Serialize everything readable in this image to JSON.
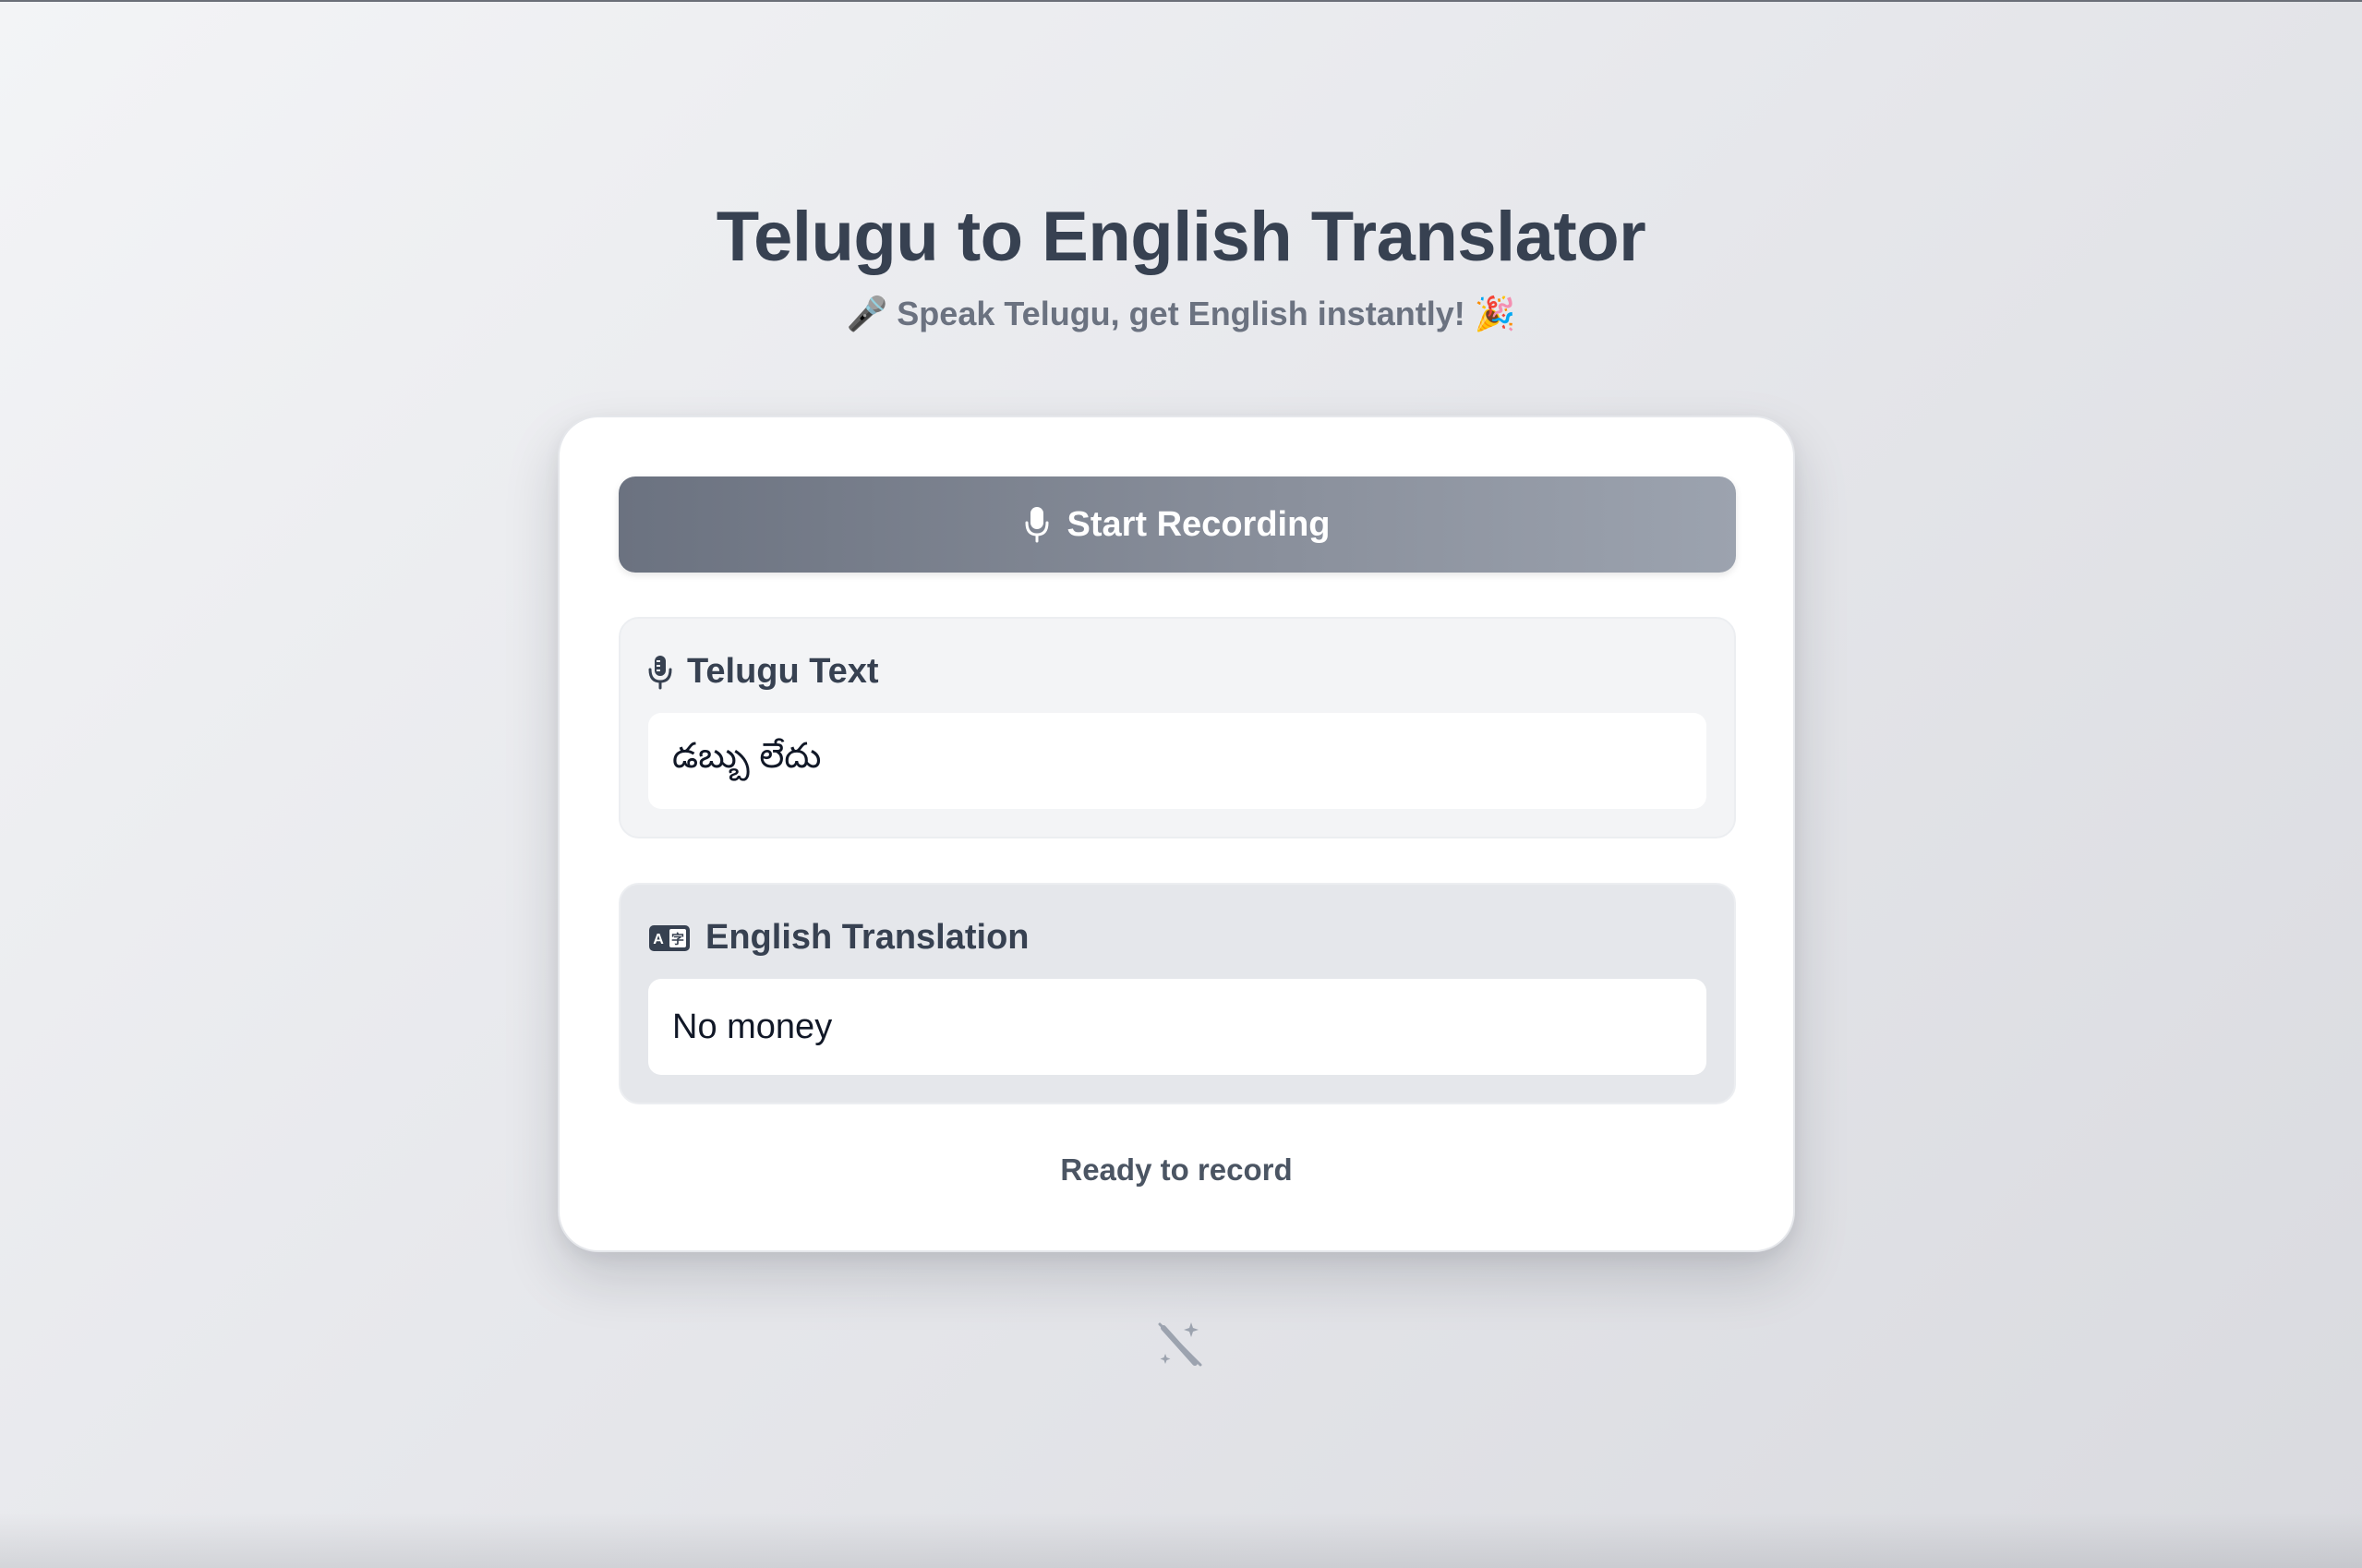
{
  "header": {
    "title": "Telugu to English Translator",
    "subtitle": "🎤 Speak Telugu, get English instantly! 🎉"
  },
  "record_button": {
    "label": "Start Recording",
    "icon": "microphone-icon"
  },
  "telugu_panel": {
    "label": "Telugu Text",
    "icon": "microphone-stand-icon",
    "value": "డబ్బు లేదు"
  },
  "english_panel": {
    "label": "English Translation",
    "icon": "translate-icon",
    "value": "No money"
  },
  "status": {
    "text": "Ready to record"
  },
  "footer": {
    "icon": "magic-wand-off-icon"
  },
  "colors": {
    "title": "#374151",
    "subtitle": "#6b7280",
    "button_gradient_start": "#6b7280",
    "button_gradient_end": "#9ca3af",
    "panel_telugu_bg": "#f3f4f6",
    "panel_english_bg": "#e5e7eb"
  }
}
